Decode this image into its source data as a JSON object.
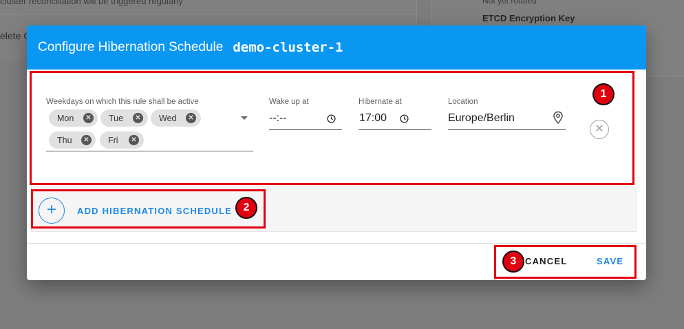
{
  "background": {
    "left_line1": "cluster reconciliation will be triggered regularly",
    "left_line2": "elete C",
    "right_line1": "Not yet rotated",
    "right_line2": "ETCD Encryption Key"
  },
  "dialog": {
    "title": "Configure Hibernation Schedule",
    "cluster_name": "demo-cluster-1"
  },
  "schedule": {
    "weekdays_label": "Weekdays on which this rule shall be active",
    "days": [
      "Mon",
      "Tue",
      "Wed",
      "Thu",
      "Fri"
    ],
    "wake_label": "Wake up at",
    "wake_value": "--:--",
    "hibernate_label": "Hibernate at",
    "hibernate_value": "17:00",
    "location_label": "Location",
    "location_value": "Europe/Berlin"
  },
  "add_button_label": "ADD HIBERNATION SCHEDULE",
  "footer": {
    "cancel_label": "CANCEL",
    "save_label": "SAVE"
  },
  "annotations": [
    "1",
    "2",
    "3"
  ],
  "colors": {
    "header": "#0a97f2",
    "accent": "#1e88e5",
    "annotation": "#e20010"
  }
}
